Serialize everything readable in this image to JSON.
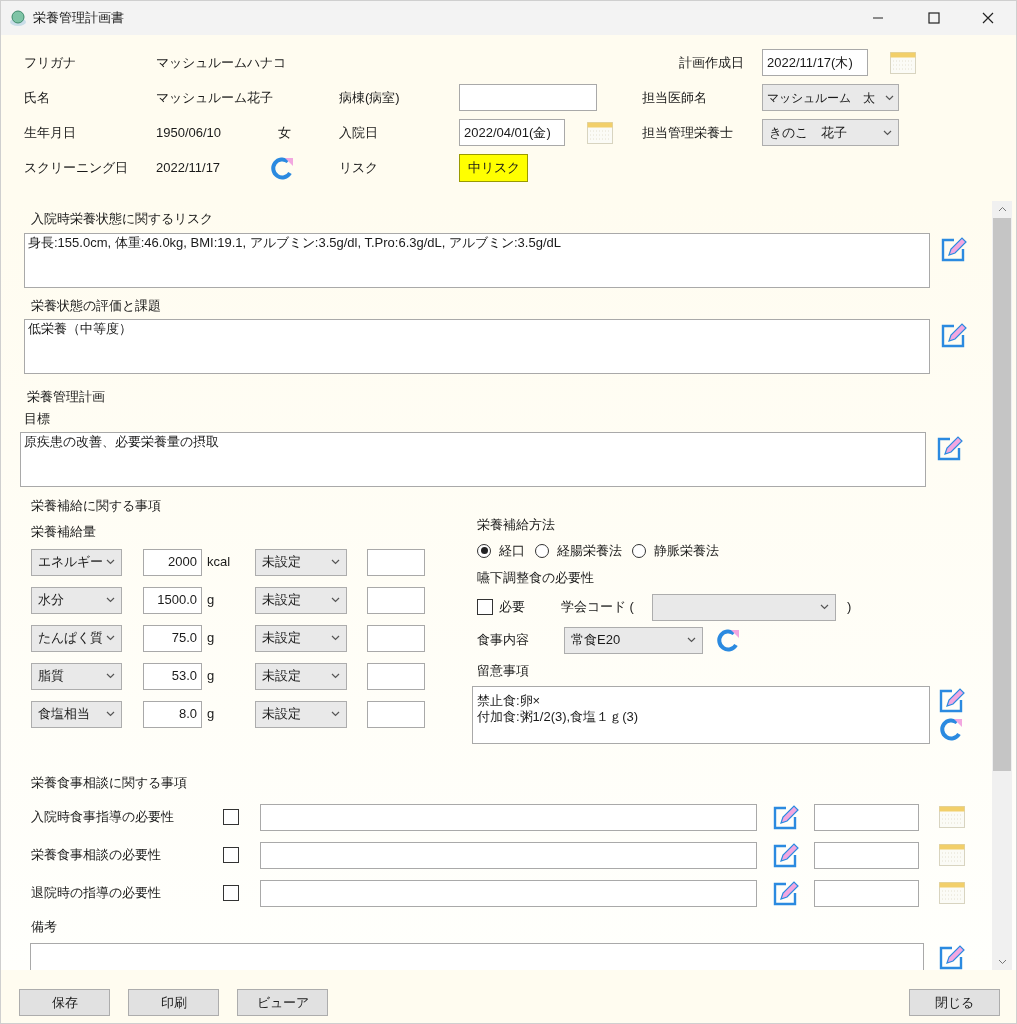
{
  "window": {
    "title": "栄養管理計画書"
  },
  "patient": {
    "furigana": {
      "label": "フリガナ",
      "value": "マッシュルームハナコ"
    },
    "name": {
      "label": "氏名",
      "value": "マッシュルーム花子"
    },
    "birth_date": {
      "label": "生年月日",
      "value": "1950/06/10"
    },
    "sex": "女",
    "screening_date": {
      "label": "スクリーニング日",
      "value": "2022/11/17"
    }
  },
  "ward": {
    "label": "病棟(病室)"
  },
  "admission_date": {
    "label": "入院日",
    "value": "2022/04/01(金)"
  },
  "risk": {
    "label": "リスク",
    "value": "中リスク"
  },
  "plan_date": {
    "label": "計画作成日",
    "value": "2022/11/17(木)"
  },
  "doctor": {
    "label": "担当医師名",
    "value": "マッシュルーム　太"
  },
  "dietitian": {
    "label": "担当管理栄養士",
    "value": "きのこ　花子"
  },
  "admission_risk": {
    "label": "入院時栄養状態に関するリスク",
    "value": "身長:155.0cm, 体重:46.0kg, BMI:19.1, アルブミン:3.5g/dl,  T.Pro:6.3g/dL, アルブミン:3.5g/dL"
  },
  "assessment": {
    "label": "栄養状態の評価と課題",
    "value": "低栄養（中等度）"
  },
  "plan_heading": "栄養管理計画",
  "goal": {
    "label": "目標",
    "value": "原疾患の改善、必要栄養量の摂取"
  },
  "supply": {
    "title": "栄養補給に関する事項",
    "amount_label": "栄養補給量",
    "rows": [
      {
        "nutrient": "エネルギー",
        "value": "2000",
        "unit": "kcal",
        "setting": "未設定"
      },
      {
        "nutrient": "水分",
        "value": "1500.0",
        "unit": "g",
        "setting": "未設定"
      },
      {
        "nutrient": "たんぱく質",
        "value": "75.0",
        "unit": "g",
        "setting": "未設定"
      },
      {
        "nutrient": "脂質",
        "value": "53.0",
        "unit": "g",
        "setting": "未設定"
      },
      {
        "nutrient": "食塩相当",
        "value": "8.0",
        "unit": "g",
        "setting": "未設定"
      }
    ]
  },
  "method": {
    "label": "栄養補給方法",
    "options": [
      {
        "label": "経口",
        "selected": true
      },
      {
        "label": "経腸栄養法",
        "selected": false
      },
      {
        "label": "静脈栄養法",
        "selected": false
      }
    ]
  },
  "dysphagia": {
    "label": "嚥下調整食の必要性",
    "required": {
      "label": "必要",
      "checked": false
    },
    "code_label": "学会コード (",
    "code_close": ")"
  },
  "meal": {
    "label": "食事内容",
    "value": "常食E20"
  },
  "notes": {
    "label": "留意事項",
    "lines": [
      "禁止食:卵×",
      "付加食:粥1/2(3),食塩１ｇ(3)"
    ]
  },
  "counseling": {
    "title": "栄養食事相談に関する事項",
    "rows": [
      {
        "label": "入院時食事指導の必要性",
        "checked": false
      },
      {
        "label": "栄養食事相談の必要性",
        "checked": false
      },
      {
        "label": "退院時の指導の必要性",
        "checked": false
      }
    ]
  },
  "remarks": {
    "label": "備考"
  },
  "buttons": [
    {
      "label": "保存"
    },
    {
      "label": "印刷"
    },
    {
      "label": "ビューア"
    }
  ],
  "close_button": {
    "label": "閉じる"
  }
}
